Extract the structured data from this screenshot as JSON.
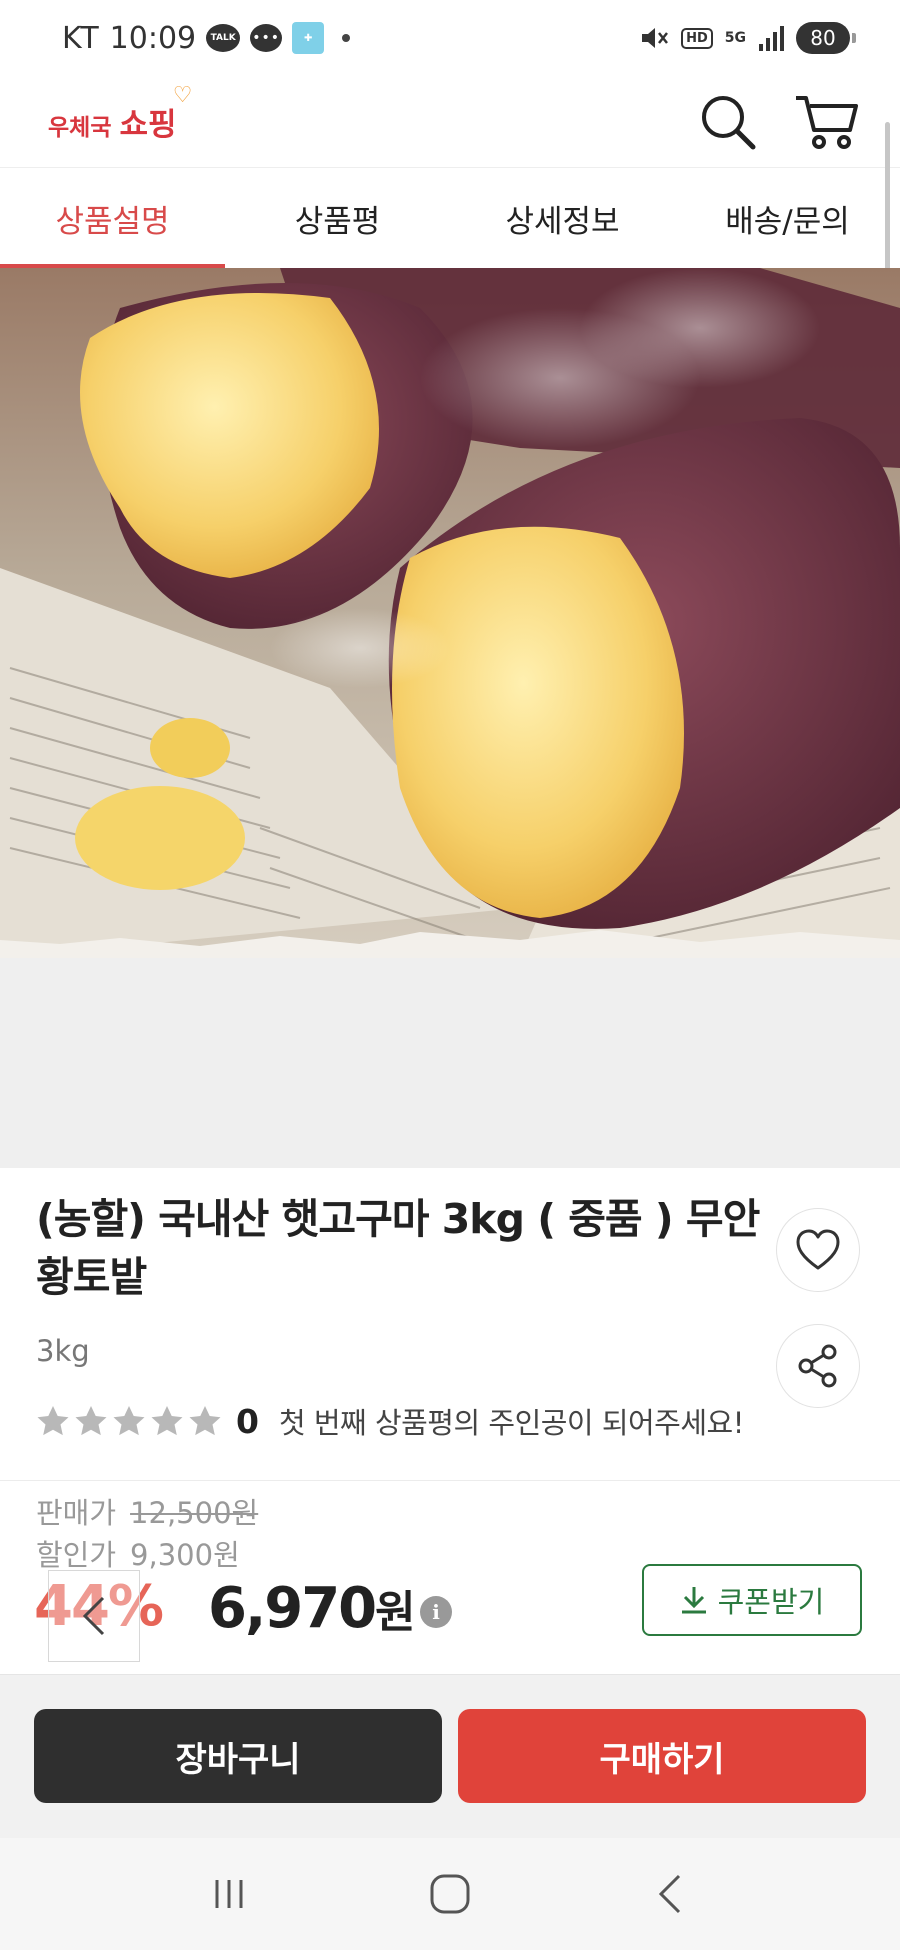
{
  "status_bar": {
    "carrier": "KT",
    "time": "10:09",
    "talk_label": "TALK",
    "msg_label": "•••",
    "hd_label": "HD",
    "network": "5G",
    "battery": "80"
  },
  "header": {
    "logo_small": "우체국",
    "logo_big": "쇼핑"
  },
  "tabs": [
    {
      "label": "상품설명",
      "active": true
    },
    {
      "label": "상품평",
      "active": false
    },
    {
      "label": "상세정보",
      "active": false
    },
    {
      "label": "배송/문의",
      "active": false
    }
  ],
  "product": {
    "title": "(농할) 국내산 햇고구마 3kg ( 중품 ) 무안 황토밭",
    "weight": "3kg",
    "review_count": "0",
    "review_message": "첫 번째 상품평의 주인공이 되어주세요!",
    "sale_price_label": "판매가",
    "sale_price": "12,500원",
    "discount_price_label": "할인가",
    "discount_price": "9,300원",
    "discount_rate": "44%",
    "final_price": "6,970",
    "final_price_unit": "원",
    "info_label": "i",
    "coupon_label": "쿠폰받기"
  },
  "actions": {
    "cart_label": "장바구니",
    "buy_label": "구매하기"
  },
  "colors": {
    "brand_red": "#d8363e",
    "buy_red": "#e0433a",
    "coupon_green": "#2b7a3f",
    "cart_dark": "#2f2f2f"
  }
}
